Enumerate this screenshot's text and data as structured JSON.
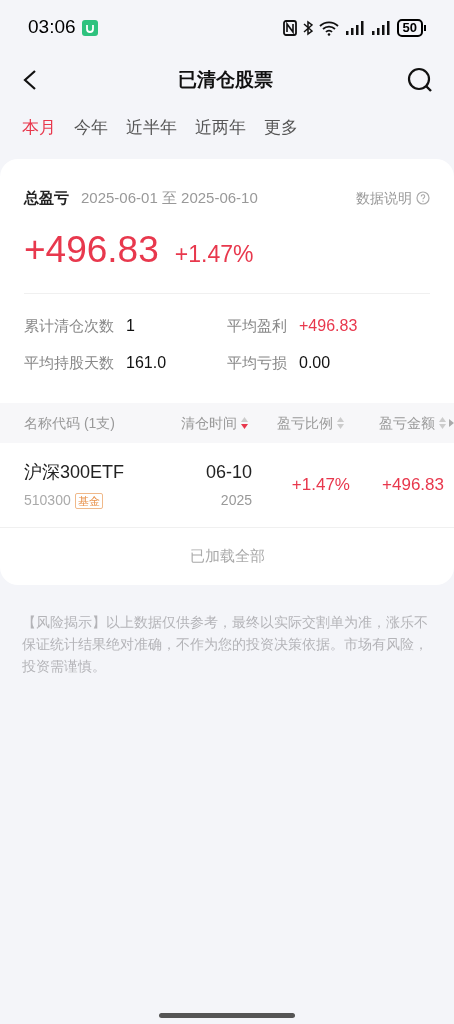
{
  "status_bar": {
    "time": "03:06",
    "battery": "50"
  },
  "header": {
    "title": "已清仓股票"
  },
  "tabs": [
    {
      "label": "本月",
      "selected": true
    },
    {
      "label": "今年",
      "selected": false
    },
    {
      "label": "近半年",
      "selected": false
    },
    {
      "label": "近两年",
      "selected": false
    },
    {
      "label": "更多",
      "selected": false
    }
  ],
  "summary": {
    "label": "总盈亏",
    "date_range": "2025-06-01 至 2025-06-10",
    "help": "数据说明",
    "total": "+496.83",
    "percent": "+1.47%",
    "stats": [
      {
        "label": "累计清仓次数",
        "value": "1",
        "positive": false
      },
      {
        "label": "平均盈利",
        "value": "+496.83",
        "positive": true
      },
      {
        "label": "平均持股天数",
        "value": "161.0",
        "positive": false
      },
      {
        "label": "平均亏损",
        "value": "0.00",
        "positive": false
      }
    ]
  },
  "table": {
    "columns": [
      {
        "label": "名称代码 (1支)",
        "sortable": false
      },
      {
        "label": "清仓时间",
        "sortable": true,
        "sorted_desc": true
      },
      {
        "label": "盈亏比例",
        "sortable": true,
        "sorted_desc": false
      },
      {
        "label": "盈亏金额",
        "sortable": true,
        "sorted_desc": false
      }
    ],
    "rows": [
      {
        "name": "沪深300ETF",
        "code": "510300",
        "tag": "基金",
        "date": "06-10",
        "year": "2025",
        "percent": "+1.47%",
        "amount": "+496.83"
      }
    ],
    "footer": "已加载全部"
  },
  "disclaimer": "【风险揭示】以上数据仅供参考，最终以实际交割单为准，涨乐不保证统计结果绝对准确，不作为您的投资决策依据。市场有风险，投资需谨慎。"
}
